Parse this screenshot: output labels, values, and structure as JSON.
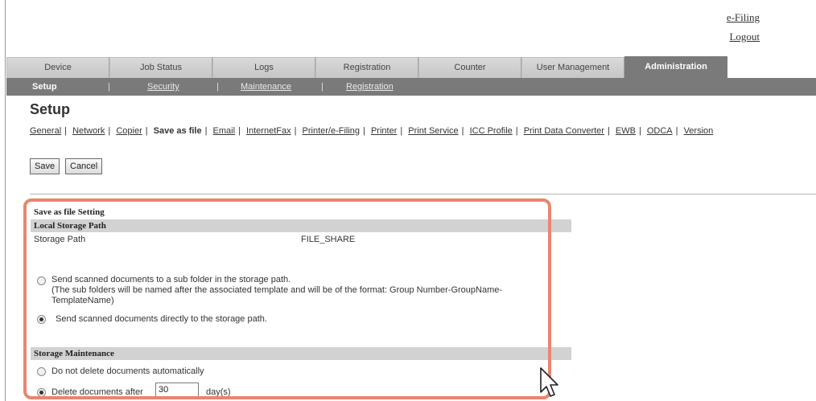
{
  "top_links": {
    "efiling": "e-Filing",
    "logout": "Logout"
  },
  "tabs": [
    "Device",
    "Job Status",
    "Logs",
    "Registration",
    "Counter",
    "User Management",
    "Administration"
  ],
  "subnav": {
    "items": [
      "Setup",
      "Security",
      "Maintenance",
      "Registration"
    ],
    "separator": "|"
  },
  "page_title": "Setup",
  "categories": [
    "General",
    "Network",
    "Copier",
    "Save as file",
    "Email",
    "InternetFax",
    "Printer/e-Filing",
    "Printer",
    "Print Service",
    "ICC Profile",
    "Print Data Converter",
    "EWB",
    "ODCA",
    "Version"
  ],
  "buttons": {
    "save": "Save",
    "cancel": "Cancel"
  },
  "settings": {
    "title": "Save as file Setting",
    "local_storage": {
      "header": "Local Storage Path",
      "storage_path_label": "Storage Path",
      "storage_path_value": "FILE_SHARE",
      "option_subfolder_line1": "Send scanned documents to a sub folder in the storage path.",
      "option_subfolder_line2": "(The sub folders will be named after the associated template and will be of the format: Group Number-GroupName-",
      "option_subfolder_line3": "TemplateName)",
      "option_direct": "Send scanned documents directly to the storage path."
    },
    "storage_maintenance": {
      "header": "Storage Maintenance",
      "option_no_delete": "Do not delete documents automatically",
      "option_delete_after": "Delete documents after",
      "days_value": "30",
      "days_unit": "day(s)"
    }
  },
  "colors": {
    "highlight": "#e88670",
    "active_tab": "#7a7a7a"
  }
}
